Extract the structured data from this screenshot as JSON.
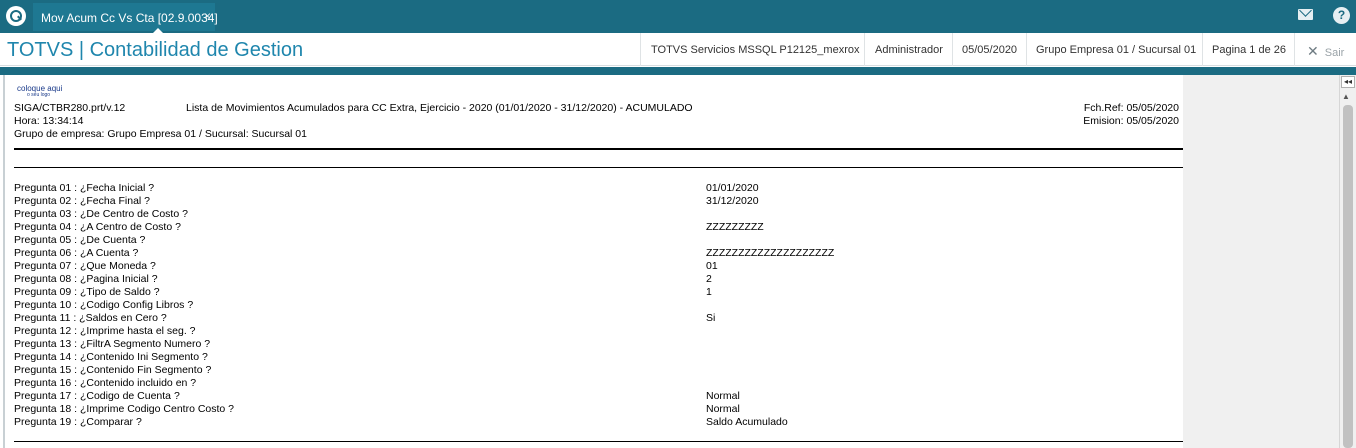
{
  "topbar": {
    "tab_title": "Mov Acum Cc Vs Cta [02.9.0034]",
    "tab_close": "×",
    "help_glyph": "?",
    "icons": [
      "totvs-logo-icon",
      "mail-icon",
      "help-icon"
    ]
  },
  "header": {
    "app_title": "TOTVS | Contabilidad de Gestion",
    "server": "TOTVS Servicios MSSQL P12125_mexrox",
    "user": "Administrador",
    "date": "05/05/2020",
    "company": "Grupo Empresa 01 / Sucursal 01",
    "page": "Pagina 1 de 26",
    "exit_label": "Sair"
  },
  "report": {
    "logo_text": "coloque aqui",
    "logo_sub": "o seu logo",
    "program": "SIGA/CTBR280.prt/v.12",
    "title": "Lista de Movimientos Acumulados para CC Extra, Ejercicio - 2020 (01/01/2020 - 31/12/2020) - ACUMULADO",
    "ref_date": "Fch.Ref: 05/05/2020",
    "time": "Hora: 13:34:14",
    "emission": "Emision: 05/05/2020",
    "company_line": "Grupo de empresa: Grupo Empresa 01 / Sucursal: Sucursal 01",
    "questions": [
      {
        "label": "Pregunta 01 : ¿Fecha Inicial ?",
        "value": "01/01/2020"
      },
      {
        "label": "Pregunta 02 : ¿Fecha Final ?",
        "value": "31/12/2020"
      },
      {
        "label": "Pregunta 03 : ¿De Centro de Costo ?",
        "value": ""
      },
      {
        "label": "Pregunta 04 : ¿A Centro de Costo ?",
        "value": "ZZZZZZZZZ"
      },
      {
        "label": "Pregunta 05 : ¿De Cuenta ?",
        "value": ""
      },
      {
        "label": "Pregunta 06 : ¿A Cuenta ?",
        "value": "ZZZZZZZZZZZZZZZZZZZZ"
      },
      {
        "label": "Pregunta 07 : ¿Que Moneda ?",
        "value": "01"
      },
      {
        "label": "Pregunta 08 : ¿Pagina Inicial ?",
        "value": "2"
      },
      {
        "label": "Pregunta 09 : ¿Tipo de Saldo ?",
        "value": "1"
      },
      {
        "label": "Pregunta 10 : ¿Codigo Config Libros ?",
        "value": ""
      },
      {
        "label": "Pregunta 11 : ¿Saldos en Cero ?",
        "value": "Si"
      },
      {
        "label": "Pregunta 12 : ¿Imprime hasta el seg. ?",
        "value": ""
      },
      {
        "label": "Pregunta 13 : ¿FiltrA Segmento Numero ?",
        "value": ""
      },
      {
        "label": "Pregunta 14 : ¿Contenido Ini Segmento ?",
        "value": ""
      },
      {
        "label": "Pregunta 15 : ¿Contenido Fin Segmento ?",
        "value": ""
      },
      {
        "label": "Pregunta 16 : ¿Contenido incluido en ?",
        "value": ""
      },
      {
        "label": "Pregunta 17 : ¿Codigo de Cuenta ?",
        "value": "Normal"
      },
      {
        "label": "Pregunta 18 : ¿Imprime Codigo Centro Costo ?",
        "value": "Normal"
      },
      {
        "label": "Pregunta 19 : ¿Comparar ?",
        "value": "Saldo Acumulado"
      }
    ]
  },
  "colors": {
    "topbar": "#1b6b82",
    "title_blue": "#1f86ad"
  }
}
